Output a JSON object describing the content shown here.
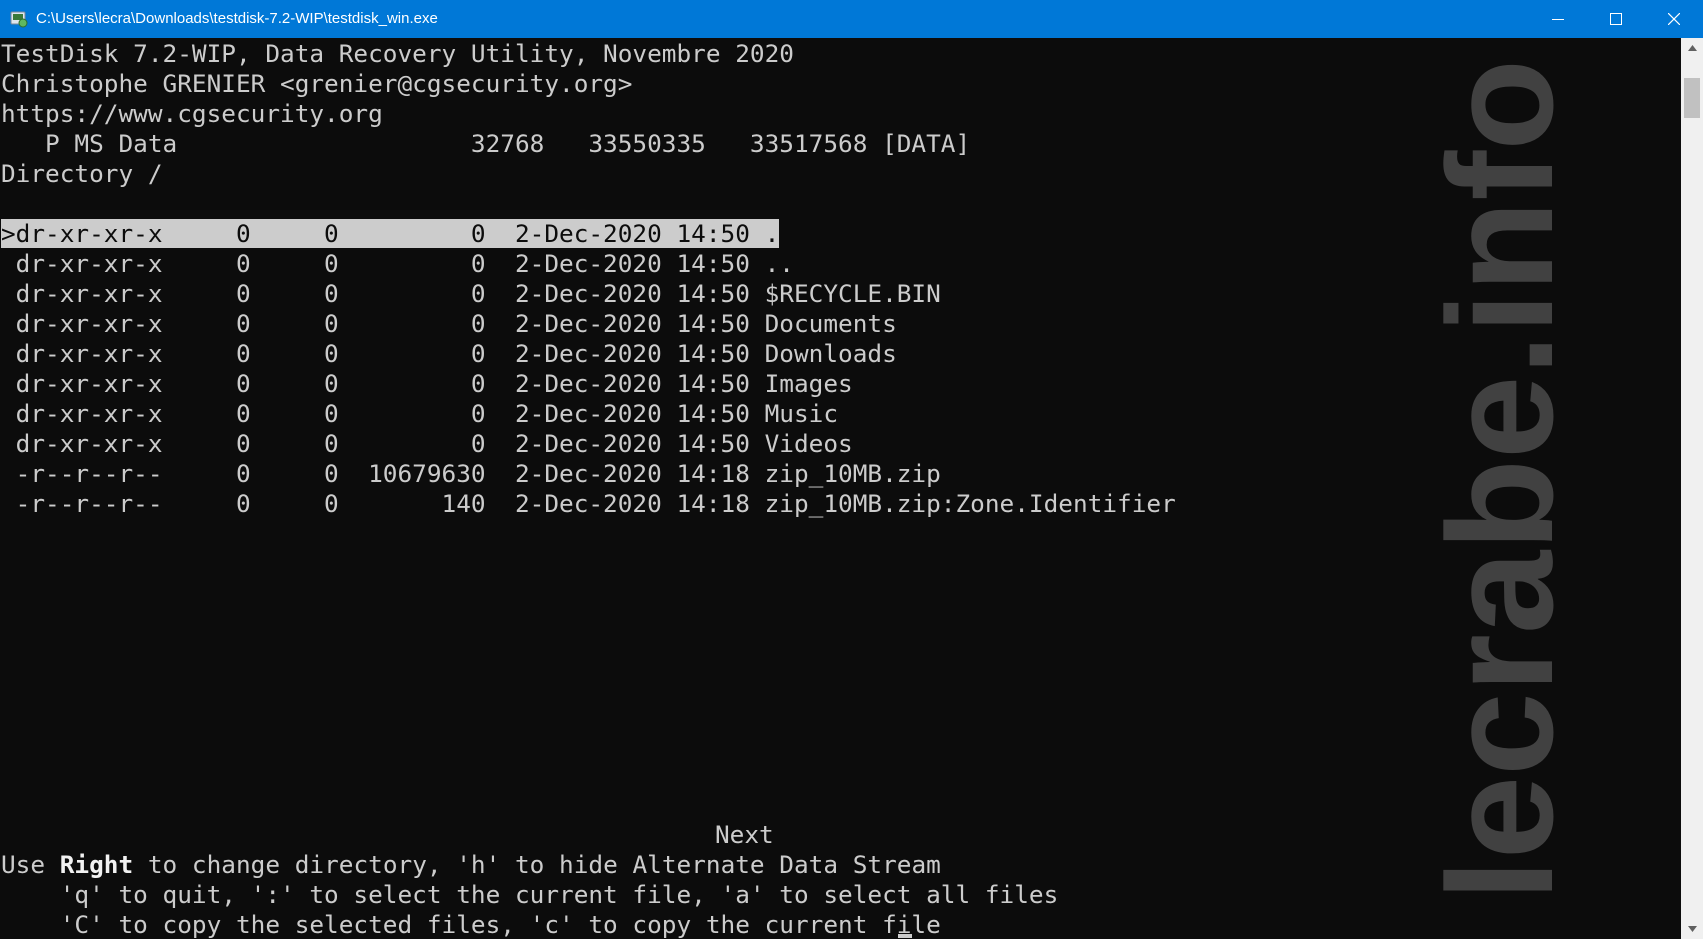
{
  "window": {
    "title": "C:\\Users\\lecra\\Downloads\\testdisk-7.2-WIP\\testdisk_win.exe",
    "icon": "testdisk-app-icon",
    "controls": [
      "minimize-icon",
      "maximize-icon",
      "close-icon"
    ]
  },
  "header": {
    "line1": "TestDisk 7.2-WIP, Data Recovery Utility, Novembre 2020",
    "line2": "Christophe GRENIER <grenier@cgsecurity.org>",
    "line3": "https://www.cgsecurity.org",
    "partition": "   P MS Data                    32768   33550335   33517568 [DATA]",
    "directory": "Directory /"
  },
  "listing": {
    "selected_index": 0,
    "rows": [
      {
        "text": ">dr-xr-xr-x     0     0         0  2-Dec-2020 14:50 ."
      },
      {
        "text": " dr-xr-xr-x     0     0         0  2-Dec-2020 14:50 .."
      },
      {
        "text": " dr-xr-xr-x     0     0         0  2-Dec-2020 14:50 $RECYCLE.BIN"
      },
      {
        "text": " dr-xr-xr-x     0     0         0  2-Dec-2020 14:50 Documents"
      },
      {
        "text": " dr-xr-xr-x     0     0         0  2-Dec-2020 14:50 Downloads"
      },
      {
        "text": " dr-xr-xr-x     0     0         0  2-Dec-2020 14:50 Images"
      },
      {
        "text": " dr-xr-xr-x     0     0         0  2-Dec-2020 14:50 Music"
      },
      {
        "text": " dr-xr-xr-x     0     0         0  2-Dec-2020 14:50 Videos"
      },
      {
        "text": " -r--r--r--     0     0  10679630  2-Dec-2020 14:18 zip_10MB.zip"
      },
      {
        "text": " -r--r--r--     0     0       140  2-Dec-2020 14:18 zip_10MB.zip:Zone.Identifier"
      }
    ]
  },
  "footer": {
    "next": "Next",
    "help1_prefix": "Use ",
    "help1_key": "Right",
    "help1_suffix": " to change directory, 'h' to hide Alternate Data Stream",
    "help2": "    'q' to quit, ':' to select the current file, 'a' to select all files",
    "help3": "    'C' to copy the selected files, 'c' to copy the current file"
  },
  "watermark": "lecrabe.info",
  "colors": {
    "titlebar": "#0078d7",
    "console_bg": "#0c0c0c",
    "console_fg": "#cccccc"
  }
}
